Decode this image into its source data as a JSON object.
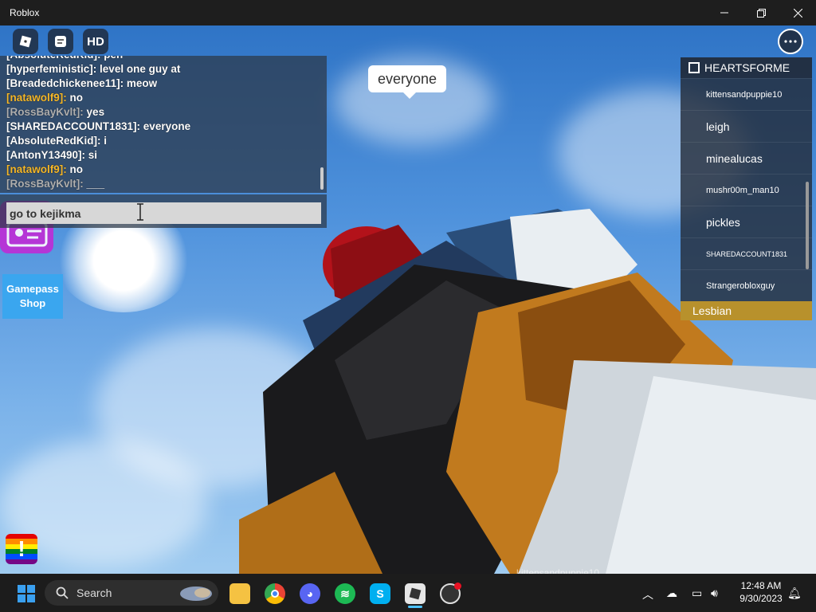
{
  "window": {
    "title": "Roblox",
    "minimize_icon": "minimize-icon",
    "maximize_icon": "restore-icon",
    "close_icon": "close-icon"
  },
  "topbar": {
    "roblox_menu_icon": "roblox-logo-icon",
    "chat_toggle_icon": "chat-icon",
    "hd_button_label": "HD",
    "more_menu_icon": "more-options-icon"
  },
  "chat": {
    "messages": [
      {
        "name": "[AbsoluteRedKid]:",
        "text": "pen",
        "name_color": "#ffffff"
      },
      {
        "name": "[hyperfeministic]:",
        "text": "level one guy at",
        "name_color": "#ffffff"
      },
      {
        "name": "[Breadedchickenee11]:",
        "text": "meow",
        "name_color": "#ffffff"
      },
      {
        "name": "[natawolf9]:",
        "text": "no",
        "name_color": "#f5b82a"
      },
      {
        "name": "[RossBayKvlt]:",
        "text": "yes",
        "name_color": "#b0b0b0"
      },
      {
        "name": "[SHAREDACCOUNT1831]:",
        "text": "everyone",
        "name_color": "#ffffff"
      },
      {
        "name": "[AbsoluteRedKid]:",
        "text": "i",
        "name_color": "#ffffff"
      },
      {
        "name": "[AntonY13490]:",
        "text": "si",
        "name_color": "#ffffff"
      },
      {
        "name": "[natawolf9]:",
        "text": "no",
        "name_color": "#f5b82a"
      },
      {
        "name": "[RossBayKvlt]:",
        "text": "___",
        "name_color": "#b0b0b0"
      }
    ],
    "input_value": "go to kejikma"
  },
  "speech_bubble": "everyone",
  "gamepass_shop": {
    "line1": "Gamepass",
    "line2": "Shop"
  },
  "player_list": {
    "header": "HEARTSFORME",
    "players": [
      {
        "name": "kittensandpuppie10",
        "size": "small"
      },
      {
        "name": "leigh",
        "size": "large"
      },
      {
        "name": "minealucas",
        "size": "large"
      },
      {
        "name": "mushr00m_man10",
        "size": "small"
      },
      {
        "name": "pickles",
        "size": "large"
      },
      {
        "name": "SHAREDACCOUNT1831",
        "size": "tiny"
      },
      {
        "name": "Strangerobloxguy",
        "size": "small"
      }
    ],
    "team_label": "Lesbian",
    "team_color": "#b8912c"
  },
  "report_flag_label": "!",
  "nametag_partial": "kittensandpuppie10",
  "taskbar": {
    "search_placeholder": "Search",
    "apps": [
      "windows-start-icon",
      "file-explorer-icon",
      "chrome-icon",
      "discord-icon",
      "spotify-icon",
      "skype-icon",
      "roblox-icon",
      "obs-icon"
    ],
    "time": "12:48 AM",
    "date": "9/30/2023"
  }
}
